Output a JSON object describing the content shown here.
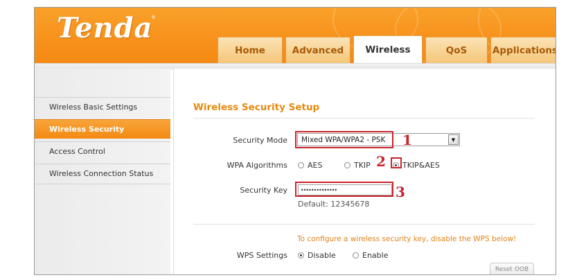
{
  "header": {
    "logo_text": "Tenda",
    "brand_color": "#f7921c",
    "tabs": [
      {
        "label": "Home",
        "active": false
      },
      {
        "label": "Advanced",
        "active": false
      },
      {
        "label": "Wireless",
        "active": true
      },
      {
        "label": "QoS",
        "active": false
      },
      {
        "label": "Applications",
        "active": false
      }
    ]
  },
  "sidebar": {
    "items": [
      {
        "label": "Wireless Basic Settings",
        "active": false
      },
      {
        "label": "Wireless Security",
        "active": true
      },
      {
        "label": "Access Control",
        "active": false
      },
      {
        "label": "Wireless Connection Status",
        "active": false
      }
    ]
  },
  "main": {
    "title": "Wireless Security Setup",
    "security_mode": {
      "label": "Security Mode",
      "selected": "Mixed WPA/WPA2 - PSK"
    },
    "wpa_algorithms": {
      "label": "WPA Algorithms",
      "options": [
        {
          "label": "AES",
          "checked": false
        },
        {
          "label": "TKIP",
          "checked": false
        },
        {
          "label": "TKIP&AES",
          "checked": true
        }
      ]
    },
    "security_key": {
      "label": "Security Key",
      "value": "••••••••••••••",
      "default_hint": "Default: 12345678"
    },
    "wps": {
      "note": "To configure a wireless security key, disable the WPS below!",
      "label": "WPS Settings",
      "options": [
        {
          "label": "Disable",
          "checked": true
        },
        {
          "label": "Enable",
          "checked": false
        }
      ],
      "reset_button": "Reset OOB"
    }
  },
  "annotations": {
    "color": "#c8232c",
    "markers": [
      "1",
      "2",
      "3"
    ]
  }
}
